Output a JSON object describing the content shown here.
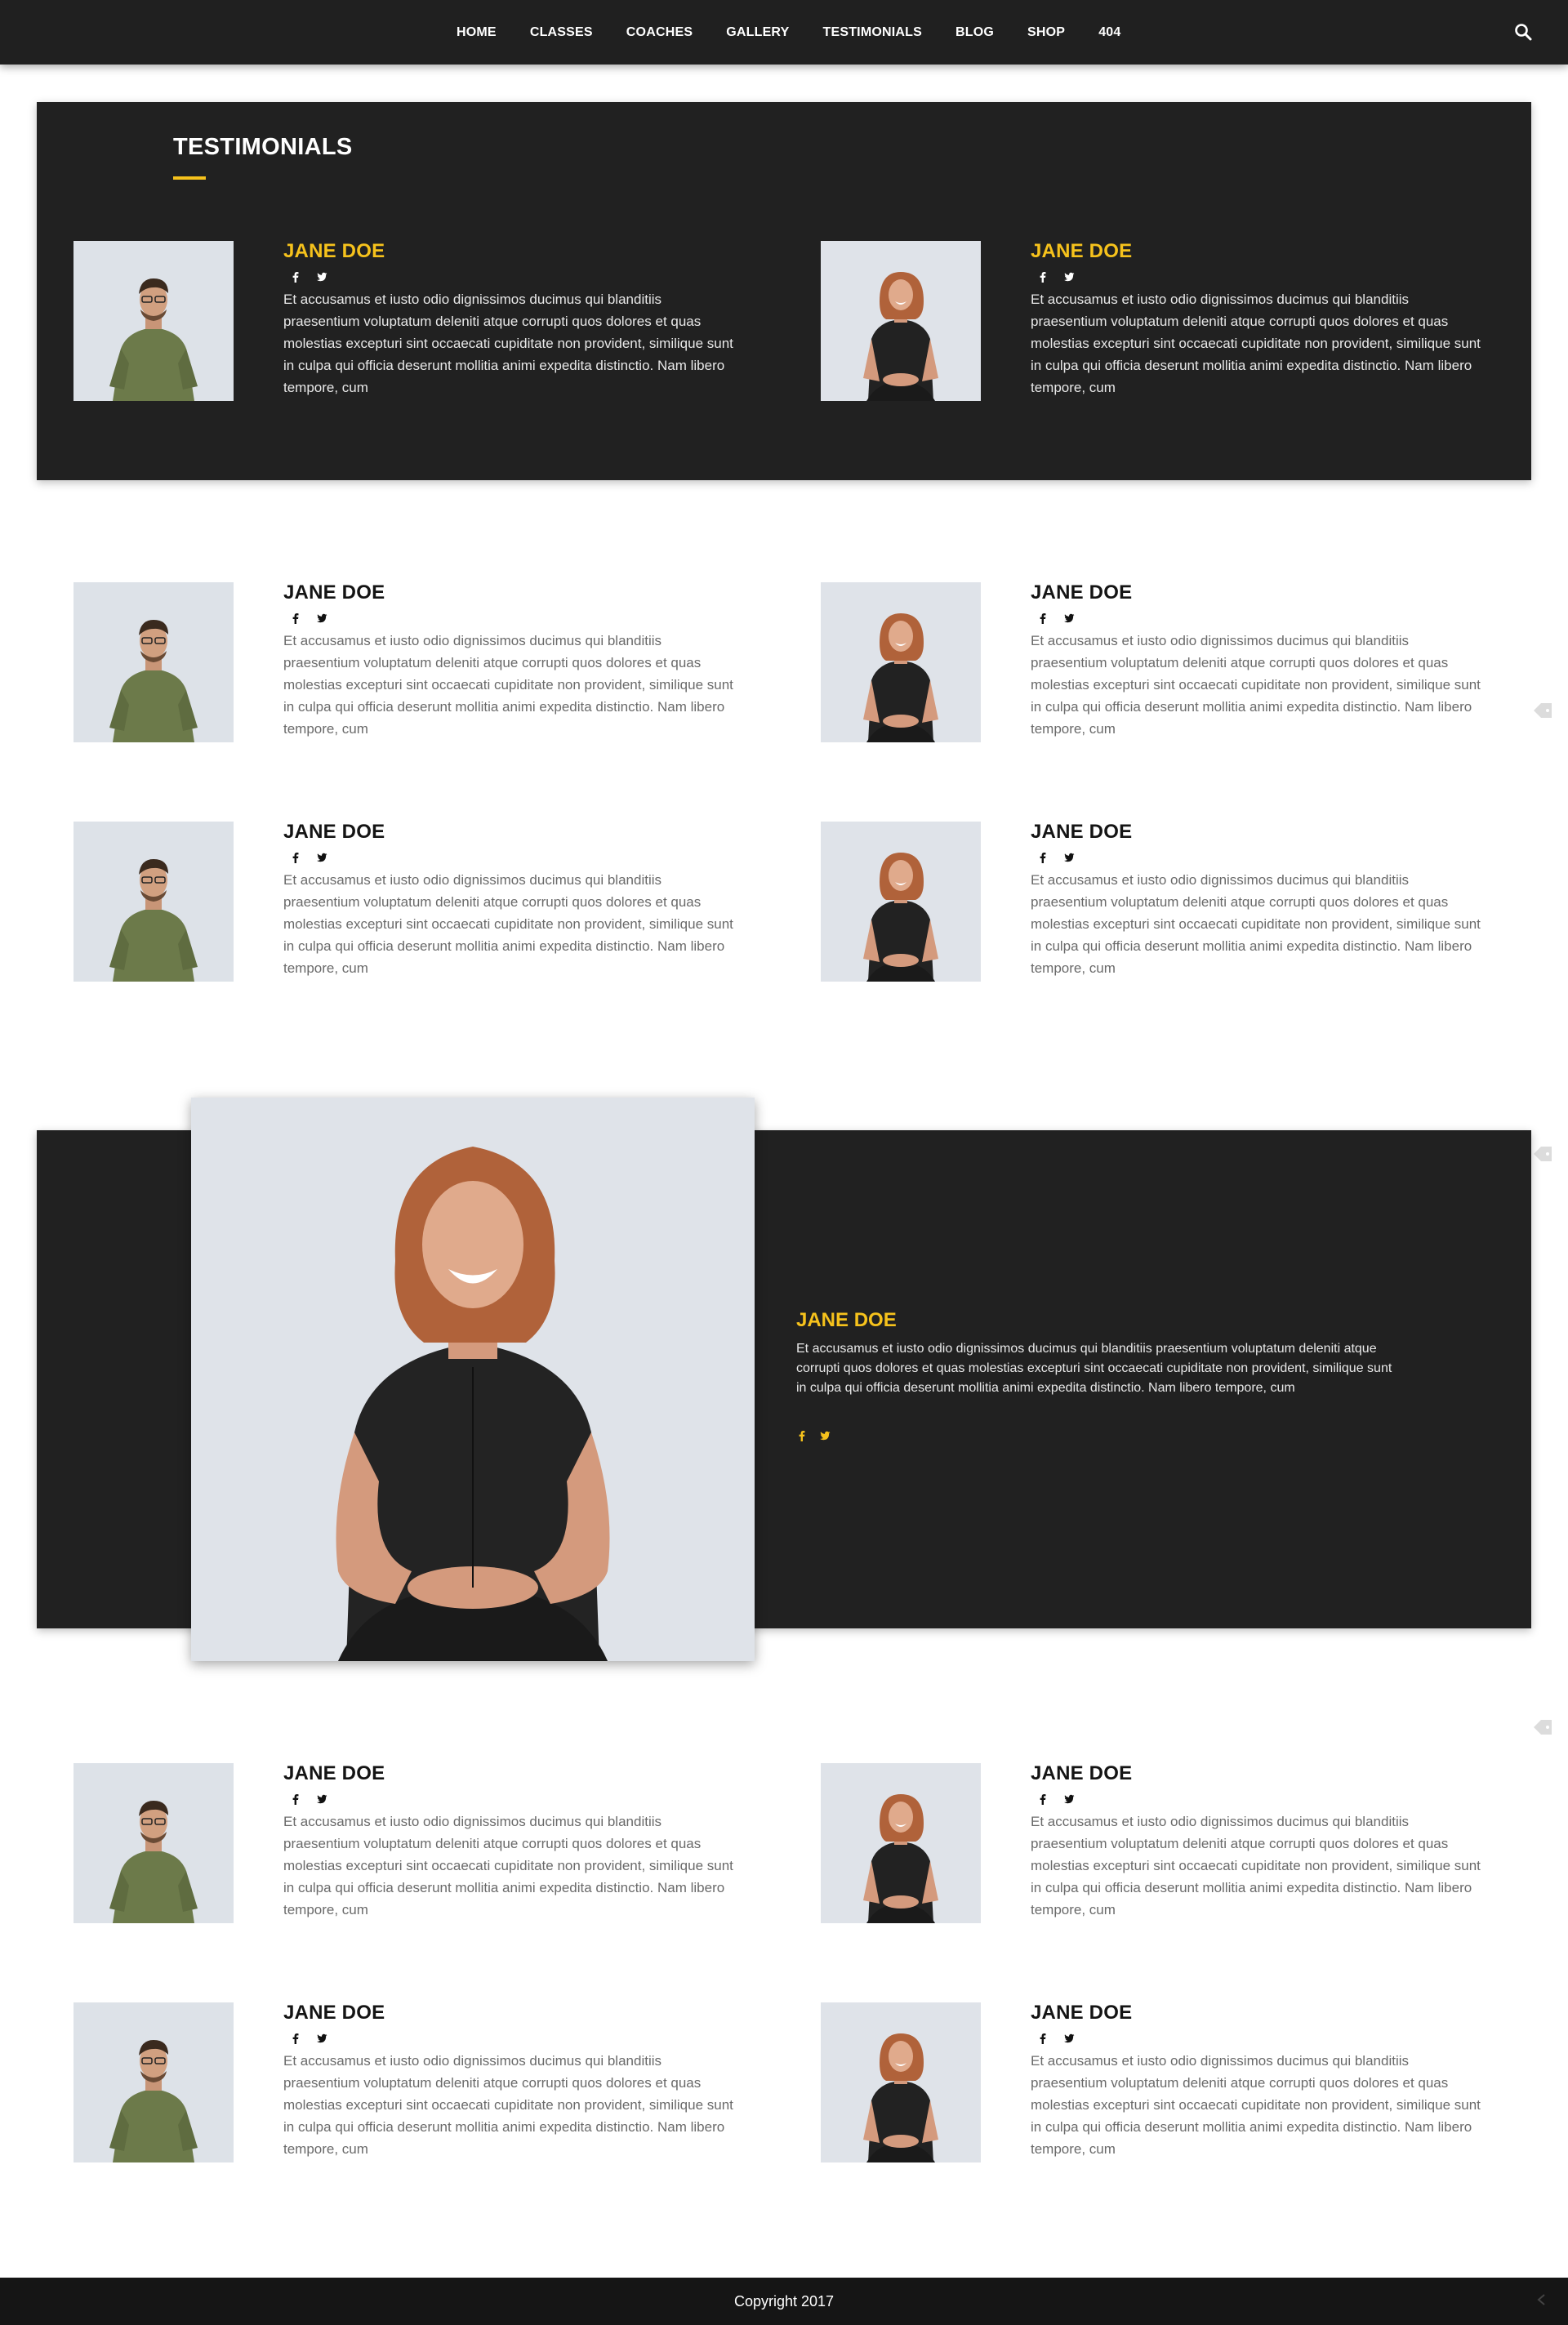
{
  "nav": {
    "items": [
      {
        "label": "HOME"
      },
      {
        "label": "CLASSES"
      },
      {
        "label": "COACHES"
      },
      {
        "label": "GALLERY"
      },
      {
        "label": "TESTIMONIALS"
      },
      {
        "label": "BLOG"
      },
      {
        "label": "SHOP"
      },
      {
        "label": "404"
      }
    ],
    "search_icon": "search-icon"
  },
  "hero": {
    "title": "TESTIMONIALS"
  },
  "testimonials": [
    {
      "name": "JANE DOE",
      "photo": "man-green-shirt",
      "text": "Et accusamus et iusto odio dignissimos ducimus qui blanditiis praesentium voluptatum deleniti atque corrupti quos dolores et quas molestias excepturi sint occaecati cupiditate non provident, similique sunt in culpa qui officia deserunt mollitia animi expedita distinctio. Nam libero tempore, cum"
    },
    {
      "name": "JANE DOE",
      "photo": "woman-black-shirt",
      "text": "Et accusamus et iusto odio dignissimos ducimus qui blanditiis praesentium voluptatum deleniti atque corrupti quos dolores et quas molestias excepturi sint occaecati cupiditate non provident, similique sunt in culpa qui officia deserunt mollitia animi expedita distinctio. Nam libero tempore, cum"
    }
  ],
  "featured": {
    "name": "JANE DOE",
    "text": "Et accusamus et iusto odio dignissimos ducimus qui blanditiis praesentium voluptatum deleniti atque corrupti quos dolores et quas molestias excepturi sint occaecati cupiditate non provident, similique sunt in culpa qui officia deserunt mollitia animi expedita distinctio. Nam libero tempore, cum"
  },
  "colors": {
    "accent": "#f6c21c",
    "dark": "#212121",
    "footer": "#151515"
  },
  "footer": {
    "copyright": "Copyright 2017"
  }
}
